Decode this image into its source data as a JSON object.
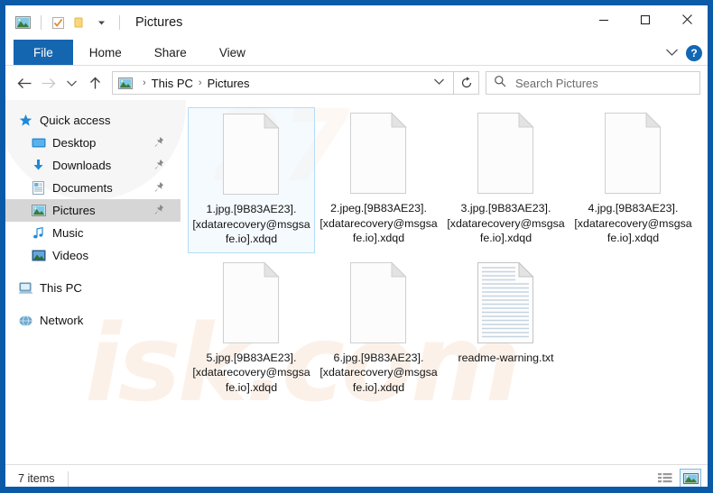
{
  "window": {
    "title": "Pictures",
    "border_color": "#0a5aa8",
    "controls": {
      "minimize": "minimize-icon",
      "maximize": "maximize-icon",
      "close": "close-icon"
    }
  },
  "quick_access_toolbar": {
    "items": [
      {
        "name": "explorer-picture-icon",
        "label": ""
      },
      {
        "name": "properties-icon",
        "label": ""
      },
      {
        "name": "new-folder-icon",
        "label": ""
      },
      {
        "name": "customize-qat-chevron-icon",
        "label": "▾"
      }
    ]
  },
  "ribbon": {
    "tabs": [
      {
        "label": "File",
        "active": true
      },
      {
        "label": "Home",
        "active": false
      },
      {
        "label": "Share",
        "active": false
      },
      {
        "label": "View",
        "active": false
      }
    ],
    "collapse_label": "⌄",
    "help_label": "?",
    "file_tab_color": "#1566b0"
  },
  "address_bar": {
    "back_label": "←",
    "forward_label": "→",
    "recent_label": "⌄",
    "up_label": "↑",
    "breadcrumbs": [
      "This PC",
      "Pictures"
    ],
    "separator": "›",
    "dropdown_label": "⌄",
    "refresh_label": "↻"
  },
  "search": {
    "placeholder": "Search Pictures",
    "value": "",
    "icon": "search-icon"
  },
  "sidebar": {
    "items": [
      {
        "label": "Quick access",
        "icon": "star-icon",
        "indent": false,
        "pinned": false,
        "selected": false,
        "gap_before": false
      },
      {
        "label": "Desktop",
        "icon": "desktop-icon",
        "indent": true,
        "pinned": true,
        "selected": false,
        "gap_before": false
      },
      {
        "label": "Downloads",
        "icon": "downloads-icon",
        "indent": true,
        "pinned": true,
        "selected": false,
        "gap_before": false
      },
      {
        "label": "Documents",
        "icon": "documents-icon",
        "indent": true,
        "pinned": true,
        "selected": false,
        "gap_before": false
      },
      {
        "label": "Pictures",
        "icon": "pictures-icon",
        "indent": true,
        "pinned": true,
        "selected": true,
        "gap_before": false
      },
      {
        "label": "Music",
        "icon": "music-icon",
        "indent": true,
        "pinned": false,
        "selected": false,
        "gap_before": false
      },
      {
        "label": "Videos",
        "icon": "videos-icon",
        "indent": true,
        "pinned": false,
        "selected": false,
        "gap_before": false
      },
      {
        "label": "This PC",
        "icon": "this-pc-icon",
        "indent": false,
        "pinned": false,
        "selected": false,
        "gap_before": true
      },
      {
        "label": "Network",
        "icon": "network-icon",
        "indent": false,
        "pinned": false,
        "selected": false,
        "gap_before": true
      }
    ]
  },
  "files": [
    {
      "name": "1.jpg.[9B83AE23].[xdatarecovery@msgsafe.io].xdqd",
      "icon": "blank-file-icon",
      "selected": true
    },
    {
      "name": "2.jpeg.[9B83AE23].[xdatarecovery@msgsafe.io].xdqd",
      "icon": "blank-file-icon",
      "selected": false
    },
    {
      "name": "3.jpg.[9B83AE23].[xdatarecovery@msgsafe.io].xdqd",
      "icon": "blank-file-icon",
      "selected": false
    },
    {
      "name": "4.jpg.[9B83AE23].[xdatarecovery@msgsafe.io].xdqd",
      "icon": "blank-file-icon",
      "selected": false
    },
    {
      "name": "5.jpg.[9B83AE23].[xdatarecovery@msgsafe.io].xdqd",
      "icon": "blank-file-icon",
      "selected": false
    },
    {
      "name": "6.jpg.[9B83AE23].[xdatarecovery@msgsafe.io].xdqd",
      "icon": "blank-file-icon",
      "selected": false
    },
    {
      "name": "readme-warning.txt",
      "icon": "text-file-icon",
      "selected": false
    }
  ],
  "status_bar": {
    "item_count_text": "7 items",
    "views": [
      {
        "name": "details-view-button",
        "active": false
      },
      {
        "name": "large-icons-view-button",
        "active": true
      }
    ]
  },
  "watermark": {
    "text_front": "isk.com",
    "text_back": "27"
  }
}
